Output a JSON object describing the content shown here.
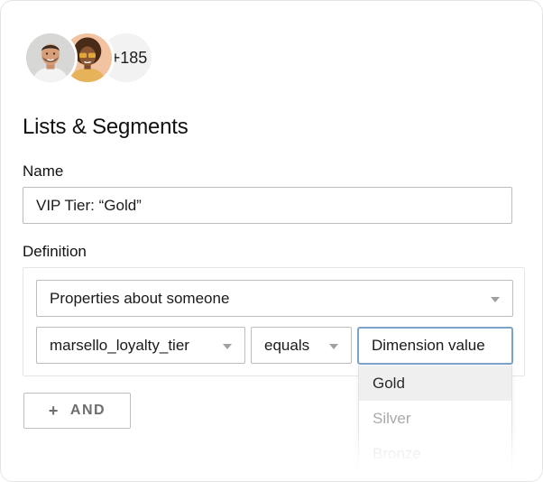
{
  "avatars": {
    "count_label": "+185"
  },
  "page": {
    "title": "Lists & Segments"
  },
  "name_field": {
    "label": "Name",
    "value": "VIP Tier: “Gold”"
  },
  "definition": {
    "label": "Definition",
    "condition_type": "Properties about someone",
    "property": "marsello_loyalty_tier",
    "operator": "equals",
    "value_placeholder": "Dimension value",
    "options": [
      "Gold",
      "Silver",
      "Bronze"
    ]
  },
  "actions": {
    "and_label": "AND"
  },
  "colors": {
    "focus_border": "#7aa3c7",
    "border": "#bdbdbd",
    "active_option_bg": "#efefef"
  }
}
